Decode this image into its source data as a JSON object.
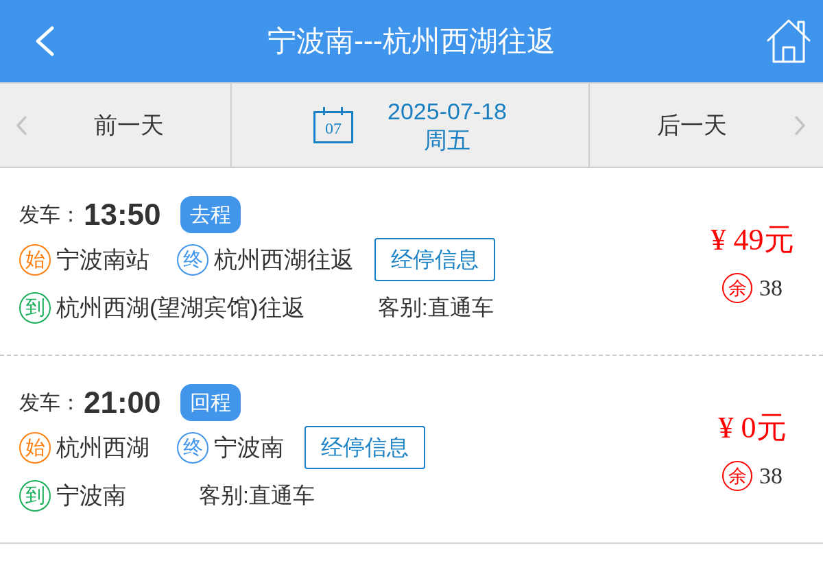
{
  "header": {
    "title": "宁波南---杭州西湖往返"
  },
  "date_bar": {
    "prev_label": "前一天",
    "calendar_day": "07",
    "date": "2025-07-18",
    "weekday": "周五",
    "next_label": "后一天"
  },
  "trips": [
    {
      "depart_label": "发车：",
      "time": "13:50",
      "direction": "去程",
      "stops": [
        {
          "kind": "start",
          "mark": "始",
          "name": "宁波南站",
          "color": "#ff7f0e"
        },
        {
          "kind": "end",
          "mark": "终",
          "name": "杭州西湖往返",
          "color": "#4196ec"
        },
        {
          "kind": "arrival",
          "mark": "到",
          "name": "杭州西湖(望湖宾馆)往返",
          "color": "#1aad5a"
        }
      ],
      "stops_button": "经停信息",
      "category": "客别:直通车",
      "price": "¥ 49元",
      "remaining": {
        "mark": "余",
        "count": "38"
      }
    },
    {
      "depart_label": "发车：",
      "time": "21:00",
      "direction": "回程",
      "stops": [
        {
          "kind": "start",
          "mark": "始",
          "name": "杭州西湖",
          "color": "#ff7f0e"
        },
        {
          "kind": "end",
          "mark": "终",
          "name": "宁波南",
          "color": "#4196ec"
        },
        {
          "kind": "arrival",
          "mark": "到",
          "name": "宁波南",
          "color": "#1aad5a"
        }
      ],
      "stops_button": "经停信息",
      "category": "客别:直通车",
      "price": "¥ 0元",
      "remaining": {
        "mark": "余",
        "count": "38"
      }
    }
  ]
}
